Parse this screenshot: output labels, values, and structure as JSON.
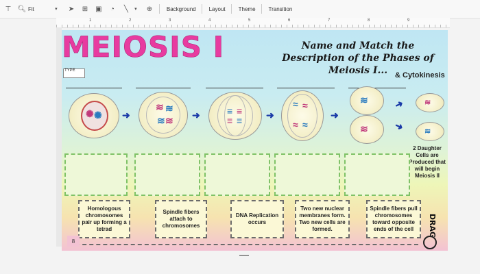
{
  "toolbar": {
    "zoom_label": "Fit",
    "menu_items": [
      "Background",
      "Layout",
      "Theme",
      "Transition"
    ]
  },
  "ruler": {
    "numbers": [
      "1",
      "2",
      "3",
      "4",
      "5",
      "6",
      "7",
      "8",
      "9"
    ]
  },
  "slide": {
    "title": "MEIOSIS I",
    "subtitle": "Name and Match the Description of the Phases of Meiosis I...",
    "type_label": "TYPE",
    "cytokinesis_label": "& Cytokinesis",
    "daughter_text": "2 Daughter Cells are Produced that will begin Meiosis II",
    "drag_label": "DRAG",
    "slide_number": "8",
    "cards": [
      "Homologous chromosomes pair up forming a tetrad",
      "Spindle fibers attach to chromosomes",
      "DNA Replication occurs",
      "Two new nuclear membranes form. Two new cells are formed.",
      "Spindle fibers pull chromosomes toward opposite ends of the cell"
    ],
    "colors": {
      "title": "#e83ba0",
      "dropzone_border": "#7fc267",
      "arrow": "#1a3aa8"
    }
  }
}
